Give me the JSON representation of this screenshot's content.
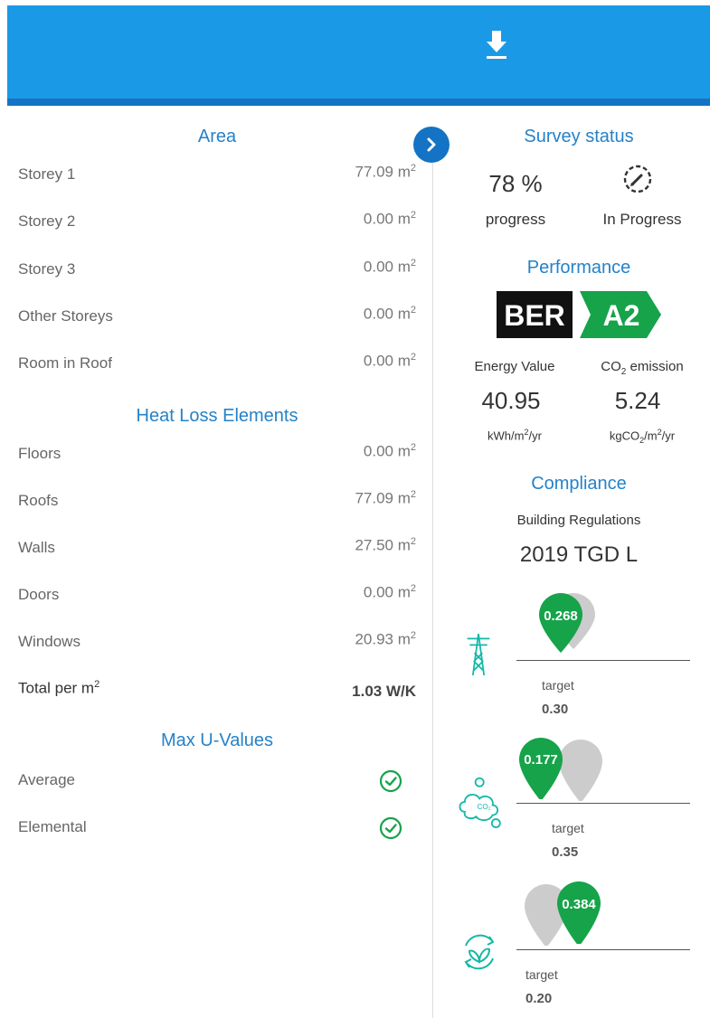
{
  "header": {
    "download_icon": "download-icon",
    "color": "#1a9ae6"
  },
  "area": {
    "title": "Area",
    "rows": [
      {
        "label": "Storey 1",
        "value": "77.09 m",
        "unit_sup": "2"
      },
      {
        "label": "Storey 2",
        "value": "0.00 m",
        "unit_sup": "2"
      },
      {
        "label": "Storey 3",
        "value": "0.00 m",
        "unit_sup": "2"
      },
      {
        "label": "Other Storeys",
        "value": "0.00 m",
        "unit_sup": "2"
      },
      {
        "label": "Room in Roof",
        "value": "0.00 m",
        "unit_sup": "2"
      }
    ]
  },
  "heat_loss": {
    "title": "Heat Loss Elements",
    "rows": [
      {
        "label": "Floors",
        "value": "0.00 m",
        "unit_sup": "2"
      },
      {
        "label": "Roofs",
        "value": "77.09 m",
        "unit_sup": "2"
      },
      {
        "label": "Walls",
        "value": "27.50 m",
        "unit_sup": "2"
      },
      {
        "label": "Doors",
        "value": "0.00 m",
        "unit_sup": "2"
      },
      {
        "label": "Windows",
        "value": "20.93 m",
        "unit_sup": "2"
      }
    ],
    "total_label": "Total per m",
    "total_label_sup": "2",
    "total_value": "1.03 W/K"
  },
  "max_u": {
    "title": "Max U-Values",
    "rows": [
      {
        "label": "Average",
        "status": "pass"
      },
      {
        "label": "Elemental",
        "status": "pass"
      }
    ]
  },
  "survey": {
    "title": "Survey status",
    "progress_value": "78 %",
    "progress_label": "progress",
    "status_label": "In Progress",
    "status_icon": "edit-progress-icon"
  },
  "performance": {
    "title": "Performance",
    "ber_prefix": "BER",
    "ber_rating": "A2",
    "energy_label": "Energy Value",
    "co2_label_pre": "CO",
    "co2_label_sub": "2",
    "co2_label_post": " emission",
    "energy_value": "40.95",
    "energy_unit_pre": "kWh/m",
    "energy_unit_sup": "2",
    "energy_unit_post": "/yr",
    "co2_value": "5.24",
    "co2_unit_pre": "kgCO",
    "co2_unit_sub": "2",
    "co2_unit_mid": "/m",
    "co2_unit_sup": "2",
    "co2_unit_post": "/yr"
  },
  "compliance": {
    "title": "Compliance",
    "subtitle": "Building Regulations",
    "standard": "2019 TGD L",
    "items": [
      {
        "icon": "power-tower-icon",
        "value": "0.268",
        "target_label": "target",
        "target": "0.30"
      },
      {
        "icon": "co2-cloud-icon",
        "value": "0.177",
        "target_label": "target",
        "target": "0.35"
      },
      {
        "icon": "renewable-leaf-icon",
        "value": "0.384",
        "target_label": "target",
        "target": "0.20"
      }
    ]
  },
  "colors": {
    "accent": "#2582c8",
    "pass": "#16a34a",
    "marker": "#16a34a",
    "marker_target": "#cccccc",
    "ber_green": "#16a34a"
  }
}
